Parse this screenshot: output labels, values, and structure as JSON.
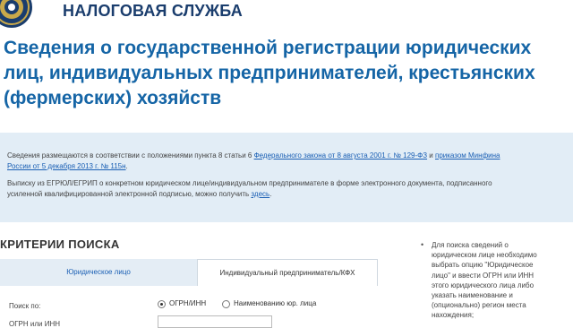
{
  "header": {
    "brand": "НАЛОГОВАЯ СЛУЖБА"
  },
  "page": {
    "title": "Сведения о государственной регистрации юридических лиц, индивидуальных предпринимателей, крестьянских (фермерских) хозяйств"
  },
  "info": {
    "p1_prefix": "Сведения размещаются в соответствии с положениями пункта 8 статьи 6 ",
    "p1_link1": "Федерального закона от 8 августа 2001 г. № 129-ФЗ",
    "p1_middle": " и ",
    "p1_link2": "приказом Минфина России от 5 декабря 2013 г. № 115н",
    "p1_suffix": ".",
    "p2_prefix": "Выписку из ЕГРЮЛ/ЕГРИП о конкретном юридическом лице/индивидуальном предпринимателе в форме электронного документа, подписанного усиленной квалифицированной электронной подписью, можно получить ",
    "p2_link": "здесь",
    "p2_suffix": "."
  },
  "search": {
    "section_title": "КРИТЕРИИ ПОИСКА",
    "tabs": [
      {
        "label": "Юридическое лицо",
        "active": true
      },
      {
        "label": "Индивидуальный предприниматель/КФХ",
        "active": false
      }
    ],
    "search_by_label": "Поиск по:",
    "options": [
      {
        "label": "ОГРН/ИНН",
        "selected": true
      },
      {
        "label": "Наименованию юр. лица",
        "selected": false
      }
    ],
    "ogrn_label": "ОГРН или ИНН",
    "ogrn_value": ""
  },
  "aside": {
    "text": "Для поиска сведений о юридическом лице необходимо выбрать опцию \"Юридическое лицо\" и ввести ОГРН или ИНН этого юридического лица либо указать наименование и (опционально) регион места нахождения;"
  },
  "colors": {
    "brand": "#1a3d6d",
    "title": "#1565a6",
    "info_bg": "#e2edf6",
    "link": "#1a5fb4",
    "active_tab_bg": "#e4edf5"
  }
}
